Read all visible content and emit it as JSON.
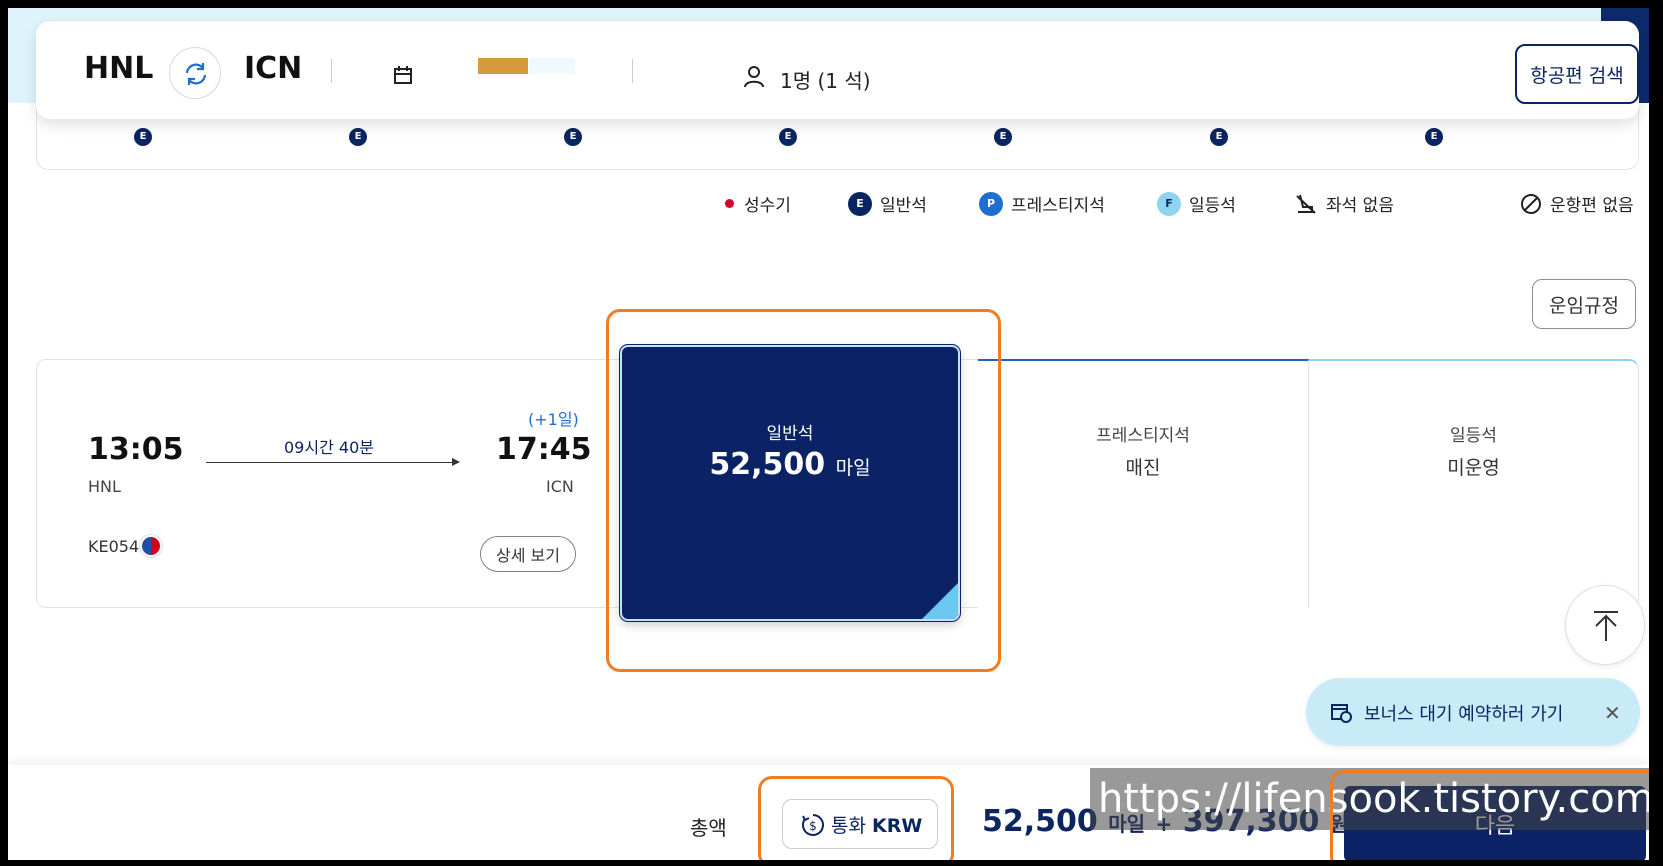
{
  "search": {
    "from": "HNL",
    "to": "ICN",
    "passengers": "1명 (1 석)",
    "search_label": "항공편 검색"
  },
  "date_strip": {
    "badges": [
      "E",
      "E",
      "E",
      "E",
      "E",
      "E",
      "E"
    ]
  },
  "legend": {
    "peak": "성수기",
    "economy_badge": "E",
    "economy": "일반석",
    "prestige_badge": "P",
    "prestige": "프레스티지석",
    "first_badge": "F",
    "first": "일등석",
    "no_seat": "좌석 없음",
    "no_flight": "운항편 없음"
  },
  "fare_rules_label": "운임규정",
  "flight": {
    "depart_time": "13:05",
    "depart_airport": "HNL",
    "duration": "09시간 40분",
    "plus_day": "(+1일)",
    "arrive_time": "17:45",
    "arrive_airport": "ICN",
    "flight_number": "KE054",
    "detail_label": "상세 보기"
  },
  "fares": {
    "economy": {
      "class": "일반석",
      "price": "52,500",
      "unit": "마일"
    },
    "prestige": {
      "class": "프레스티지석",
      "status": "매진"
    },
    "first": {
      "class": "일등석",
      "status": "미운영"
    }
  },
  "bonus_waitlist": {
    "label": "보너스 대기 예약하러 가기"
  },
  "bottom": {
    "total_label": "총액",
    "currency_label": "통화",
    "currency_code": "KRW",
    "miles": "52,500",
    "miles_unit": "마일",
    "plus": "+",
    "won": "397,300",
    "won_unit": "원",
    "next_label": "다음"
  },
  "watermark": "https://lifensook.tistory.com",
  "colors": {
    "brand_navy": "#0b2264",
    "accent_blue": "#1f5fbf",
    "highlight_orange": "#f07d22",
    "peak_red": "#d7002b"
  }
}
